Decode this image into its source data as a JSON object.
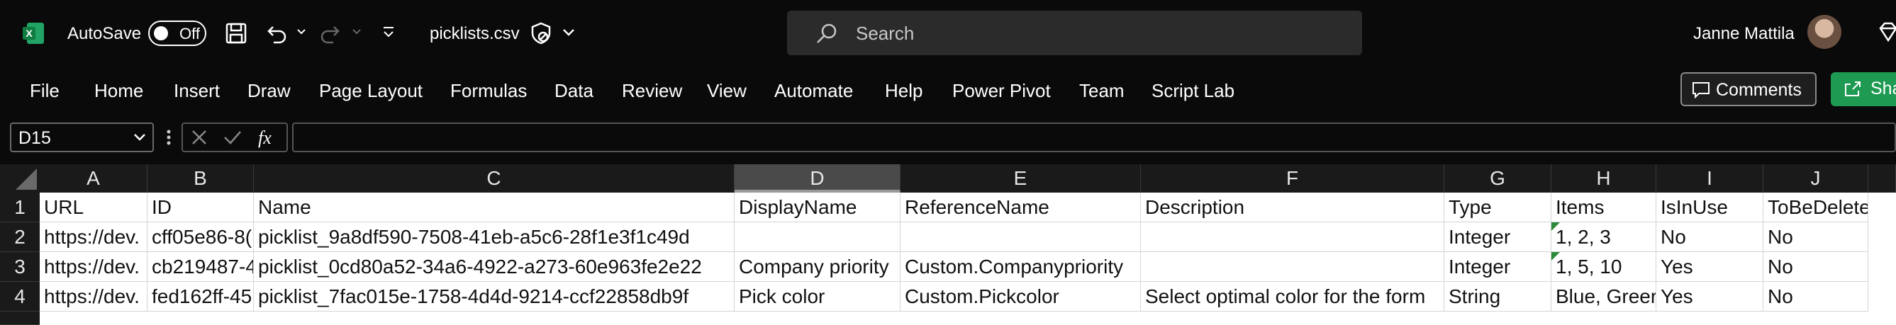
{
  "titlebar": {
    "autosave_label": "AutoSave",
    "autosave_state": "Off",
    "filename": "picklists.csv",
    "search_placeholder": "Search",
    "user_name": "Janne Mattila"
  },
  "ribbon": {
    "tabs": [
      "File",
      "Home",
      "Insert",
      "Draw",
      "Page Layout",
      "Formulas",
      "Data",
      "Review",
      "View",
      "Automate",
      "Help",
      "Power Pivot",
      "Team",
      "Script Lab"
    ],
    "comments_label": "Comments",
    "share_label": "Share"
  },
  "formula_bar": {
    "name_box": "D15",
    "formula": ""
  },
  "sheet": {
    "columns": [
      "A",
      "B",
      "C",
      "D",
      "E",
      "F",
      "G",
      "H",
      "I",
      "J"
    ],
    "selected_column": "D",
    "row_numbers": [
      "1",
      "2",
      "3",
      "4"
    ],
    "rows": [
      [
        "URL",
        "ID",
        "Name",
        "DisplayName",
        "ReferenceName",
        "Description",
        "Type",
        "Items",
        "IsInUse",
        "ToBeDeleted"
      ],
      [
        "https://dev.",
        "cff05e86-8(",
        "picklist_9a8df590-7508-41eb-a5c6-28f1e3f1c49d",
        "",
        "",
        "",
        "Integer",
        "1, 2, 3",
        "No",
        "No"
      ],
      [
        "https://dev.",
        "cb219487-4",
        "picklist_0cd80a52-34a6-4922-a273-60e963fe2e22",
        "Company priority",
        "Custom.Companypriority",
        "",
        "Integer",
        "1, 5, 10",
        "Yes",
        "No"
      ],
      [
        "https://dev.",
        "fed162ff-45",
        "picklist_7fac015e-1758-4d4d-9214-ccf22858db9f",
        "Pick color",
        "Custom.Pickcolor",
        "Select optimal color for the form",
        "String",
        "Blue, Greer",
        "Yes",
        "No"
      ]
    ]
  },
  "colors": {
    "excel_green": "#1e9a52",
    "background": "#0a0a0a",
    "cell_background": "#ffffff"
  }
}
